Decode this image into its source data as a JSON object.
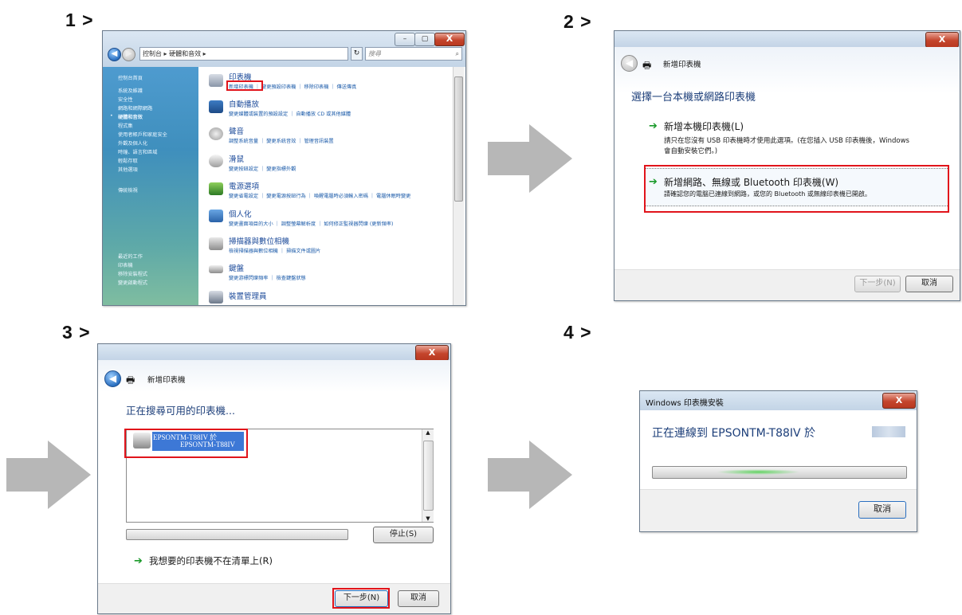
{
  "steps": {
    "s1": "1 >",
    "s2": "2 >",
    "s3": "3 >",
    "s4": "4 >"
  },
  "window1": {
    "breadcrumb": "控制台 ▸ 硬體和音效 ▸",
    "search_placeholder": "搜尋",
    "sidebar": [
      "控制台首頁",
      "系統及維護",
      "安全性",
      "網路和網際網路",
      "硬體和音效",
      "程式集",
      "使用者帳戶和家庭安全",
      "外觀及個人化",
      "時鐘、語言和區域",
      "輕鬆存取",
      "其他選項",
      "傳統檢視"
    ],
    "sidebar_bottom": [
      "最近的工作",
      "印表機",
      "移除安裝程式",
      "變更啟動程式"
    ],
    "items": [
      {
        "title": "印表機",
        "links": "新增印表機 ｜ 變更預設印表機 ｜ 移除印表機 ｜ 傳送傳真",
        "highlight": "新增印表機"
      },
      {
        "title": "自動播放",
        "links": "變更媒體或裝置的預設設定 ｜ 自動播放 CD 或其他媒體"
      },
      {
        "title": "聲音",
        "links": "調整系統音量 ｜ 變更系統音效 ｜ 管理音訊裝置"
      },
      {
        "title": "滑鼠",
        "links": "變更按鈕設定 ｜ 變更指標外觀"
      },
      {
        "title": "電源選項",
        "links": "變更省電設定 ｜ 變更電源按鈕行為 ｜ 喚醒電腦時必須輸入密碼 ｜ 電腦休眠時變更"
      },
      {
        "title": "個人化",
        "links": "變更畫面項目的大小 ｜ 調整螢幕解析度 ｜ 如何修正監視器閃爍 (更新頻率)"
      },
      {
        "title": "掃描器與數位相機",
        "links": "檢視掃描器與數位相機 ｜ 掃描文件或圖片"
      },
      {
        "title": "鍵盤",
        "links": "變更游標閃爍頻率 ｜ 檢查鍵盤狀態"
      },
      {
        "title": "裝置管理員",
        "links": ""
      }
    ]
  },
  "window2": {
    "title": "新增印表機",
    "heading": "選擇一台本機或網路印表機",
    "opt1_title": "新增本機印表機(L)",
    "opt1_desc1": "請只在您沒有 USB 印表機時才使用此選項。(在您插入 USB 印表機後，Windows",
    "opt1_desc2": "會自動安裝它們。)",
    "opt2_title": "新增網路、無線或 Bluetooth 印表機(W)",
    "opt2_desc": "請確認您的電腦已連線到網路，或您的 Bluetooth 或無線印表機已開啟。",
    "next": "下一步(N)",
    "cancel": "取消",
    "close": "X"
  },
  "window3": {
    "title": "新增印表機",
    "heading": "正在搜尋可用的印表機...",
    "printer_line1": "EPSONTM-T88IV 於",
    "printer_line2": "EPSONTM-T88IV",
    "stop": "停止(S)",
    "not_listed": "我想要的印表機不在清單上(R)",
    "next": "下一步(N)",
    "cancel": "取消",
    "close": "X"
  },
  "window4": {
    "title": "Windows 印表機安裝",
    "message": "正在連線到 EPSONTM-T88IV 於",
    "cancel": "取消",
    "close": "X"
  }
}
